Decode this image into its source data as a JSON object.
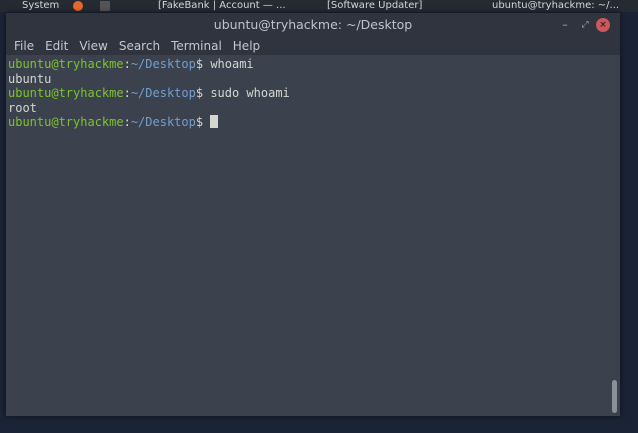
{
  "taskbar": {
    "system": "System",
    "items": [
      "[FakeBank | Account — ...",
      "[Software Updater]",
      "ubuntu@tryhackme: ~/..."
    ]
  },
  "window": {
    "title": "ubuntu@tryhackme: ~/Desktop",
    "minimize": "–",
    "maximize": "⤢",
    "close": "×"
  },
  "menu": [
    "File",
    "Edit",
    "View",
    "Search",
    "Terminal",
    "Help"
  ],
  "terminal": {
    "user_host": "ubuntu@tryhackme",
    "path": "~/Desktop",
    "lines": [
      {
        "cmd": "whoami"
      },
      {
        "out": "ubuntu"
      },
      {
        "cmd": "sudo whoami"
      },
      {
        "out": "root"
      },
      {
        "cmd": ""
      }
    ]
  },
  "colors": {
    "prompt_user": "#7bc42e",
    "prompt_path": "#729fcf",
    "background": "#3b414d"
  }
}
